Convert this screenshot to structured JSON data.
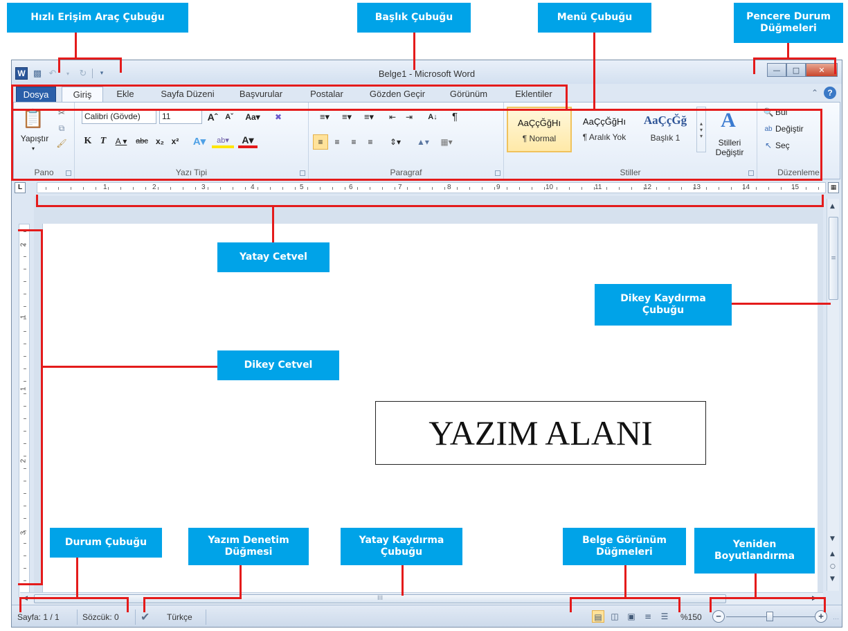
{
  "annotations": {
    "quick_access": "Hızlı Erişim Araç Çubuğu",
    "title_bar": "Başlık Çubuğu",
    "menu_bar": "Menü Çubuğu",
    "window_buttons": "Pencere Durum Düğmeleri",
    "h_ruler": "Yatay Cetvel",
    "v_scroll": "Dikey Kaydırma Çubuğu",
    "v_ruler": "Dikey Cetvel",
    "status_bar": "Durum Çubuğu",
    "spell_check": "Yazım Denetim Düğmesi",
    "h_scroll": "Yatay Kaydırma Çubuğu",
    "view_buttons": "Belge Görünüm Düğmeleri",
    "resize": "Yeniden Boyutlandırma"
  },
  "window": {
    "title": "Belge1 - Microsoft Word"
  },
  "tabs": [
    "Dosya",
    "Giriş",
    "Ekle",
    "Sayfa Düzeni",
    "Başvurular",
    "Postalar",
    "Gözden Geçir",
    "Görünüm",
    "Eklentiler"
  ],
  "ribbon": {
    "clipboard": {
      "label": "Pano",
      "paste": "Yapıştır"
    },
    "font": {
      "label": "Yazı Tipi",
      "font_name": "Calibri (Gövde)",
      "font_size": "11"
    },
    "paragraph": {
      "label": "Paragraf"
    },
    "styles": {
      "label": "Stiller",
      "items": [
        {
          "sample": "AaÇçĞğHı",
          "name": "¶ Normal"
        },
        {
          "sample": "AaÇçĞğHı",
          "name": "¶ Aralık Yok"
        },
        {
          "sample": "AaÇçĞğ",
          "name": "Başlık 1"
        }
      ],
      "change": "Stilleri Değiştir"
    },
    "editing": {
      "label": "Düzenleme",
      "find": "Bul",
      "replace": "Değiştir",
      "select": "Seç"
    }
  },
  "document": {
    "writing_area": "YAZIM ALANI"
  },
  "status": {
    "page": "Sayfa: 1 / 1",
    "words": "Sözcük: 0",
    "language": "Türkçe",
    "zoom": "%150"
  },
  "colors": {
    "callout": "#00a3e8",
    "highlight": "#e41b1b",
    "file_tab": "#2a5fa9"
  }
}
